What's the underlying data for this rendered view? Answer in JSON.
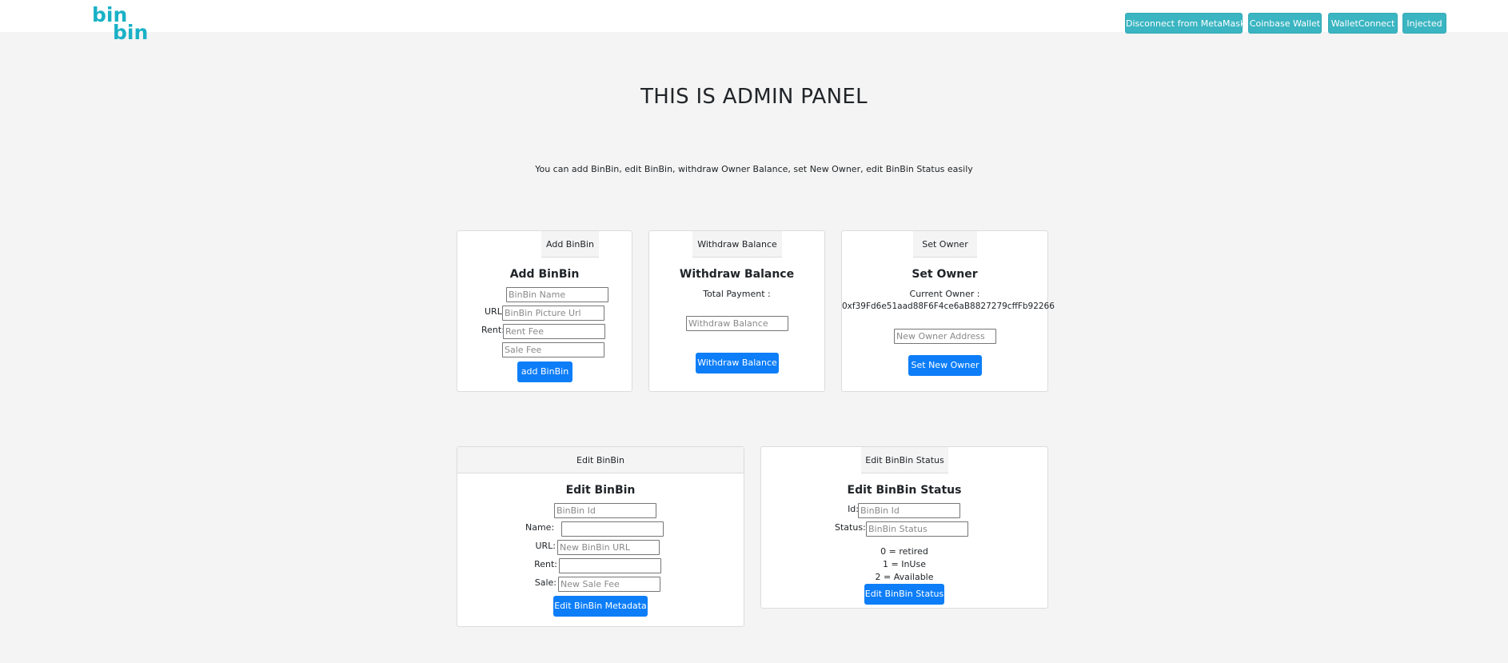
{
  "brand": {
    "line1": "bin",
    "line2": "bin"
  },
  "nav": {
    "disconnect": "Disconnect from MetaMask",
    "coinbase": "Coinbase Wallet",
    "walletconnect": "WalletConnect",
    "injected": "Injected"
  },
  "page": {
    "title": "THIS IS ADMIN PANEL",
    "subtitle": "You can add BinBin, edit BinBin, withdraw Owner Balance, set New Owner, edit BinBin Status easily"
  },
  "add_binbin": {
    "tab": "Add BinBin",
    "title": "Add BinBin",
    "name_placeholder": "BinBin Name",
    "url_label": "URL:",
    "url_placeholder": "BinBin Picture Url",
    "rent_label": "Rent:",
    "rent_placeholder": "Rent Fee",
    "sale_placeholder": "Sale Fee",
    "button": "add BinBin"
  },
  "withdraw": {
    "tab": "Withdraw Balance",
    "title": "Withdraw Balance",
    "total_label": "Total Payment :",
    "placeholder": "Withdraw Balance",
    "button": "Withdraw Balance"
  },
  "set_owner": {
    "tab": "Set Owner",
    "title": "Set Owner",
    "current_label": "Current Owner :",
    "current_address": "0xf39Fd6e51aad88F6F4ce6aB8827279cffFb92266",
    "placeholder": "New Owner Address",
    "button": "Set New Owner"
  },
  "edit_binbin": {
    "tab": "Edit BinBin",
    "title": "Edit BinBin",
    "id_placeholder": "BinBin Id",
    "name_label": "Name:",
    "name_placeholder": "",
    "url_label": "URL:",
    "url_placeholder": "New BinBin URL",
    "rent_label": "Rent:",
    "rent_placeholder": "",
    "sale_label": "Sale:",
    "sale_placeholder": "New Sale Fee",
    "button": "Edit BinBin Metadata"
  },
  "edit_status": {
    "tab": "Edit BinBin Status",
    "title": "Edit BinBin Status",
    "id_label": "Id:",
    "id_placeholder": "BinBin Id",
    "status_label": "Status:",
    "status_placeholder": "BinBin Status",
    "legend": [
      "0 = retired",
      "1 = InUse",
      "2 = Available"
    ],
    "button": "Edit BinBin Status"
  },
  "colors": {
    "brand": "#1ab1c6",
    "nav_button": "#3bb5c2",
    "primary_button": "#0d7ef8",
    "background": "#f4f4f4"
  }
}
